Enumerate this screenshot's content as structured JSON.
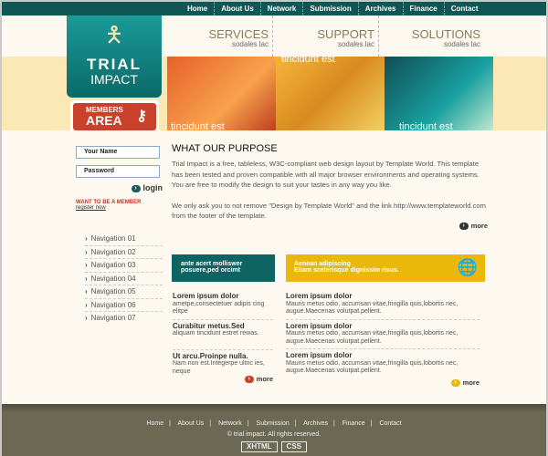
{
  "topnav": [
    "Home",
    "About Us",
    "Network",
    "Submission",
    "Archives",
    "Finance",
    "Contact"
  ],
  "logo": {
    "line1": "TRIAL",
    "line2": "IMPACT"
  },
  "members": {
    "line1": "MEMBERS",
    "line2": "AREA"
  },
  "header": [
    {
      "title": "SERVICES",
      "sub": "sodales lac"
    },
    {
      "title": "SUPPORT",
      "sub": "sodales lac"
    },
    {
      "title": "SOLUTIONS",
      "sub": "sodales lac"
    }
  ],
  "banner": {
    "caption1": "tincidunt est",
    "caption2": "tincidunt est",
    "caption3": "tincidunt est"
  },
  "sidebar": {
    "name_placeholder": "Your Name",
    "password_placeholder": "Password",
    "login": "login",
    "want": "WANT TO BE A MEMBER",
    "register": "register now",
    "nav": [
      "Navigation 01",
      "Navigation 02",
      "Navigation 03",
      "Navigation 04",
      "Navigation 05",
      "Navigation 06",
      "Navigation 07"
    ]
  },
  "main": {
    "title": "WHAT OUR PURPOSE",
    "p1": "Trial Impact is a free, tableless, W3C-compliant web design layout by Template World. This template has been tested and proven compatible with all major browser environments and operating systems. You are free to modify the design to suit your tastes in any way you like.",
    "p2": "We only ask you to not remove \"Design by Template World\" and the link http://www.templateworld.com from the footer of the template.",
    "more": "more"
  },
  "box1": {
    "line1": "ante acert molliswer",
    "line2": "posuere,ped orcimt"
  },
  "box2": {
    "line1": "Aenean adipiscing",
    "line2": "Etiam scelerisque dignissim risus."
  },
  "col1": [
    {
      "title": "Lorem ipsum dolor",
      "text": "ametpe,consectetuer adipis cing elitpe"
    },
    {
      "title": "Curabitur metus.Sed",
      "text": "aliquam tincidunt estret rewas."
    },
    {
      "title": "Ut arcu.Proinpe nulla.",
      "text": "Nam non est.Integerpe ultric ies, neque"
    }
  ],
  "col1_more": "more",
  "col2": [
    {
      "title": "Lorem ipsum dolor",
      "text": "Mauris metus odio, accumsan vitae,fringilla quis,lobortis nec, augue.Maecenas volutpat.pellent."
    },
    {
      "title": "Lorem ipsum dolor",
      "text": "Mauris metus odio, accumsan vitae,fringilla quis,lobortis nec, augue.Maecenas volutpat.pellent."
    },
    {
      "title": "Lorem ipsum dolor",
      "text": "Mauris metus odio, accumsan vitae,fringilla quis,lobortis nec, augue.Maecenas volutpat.pellent."
    }
  ],
  "col2_more": "more",
  "footer": {
    "links": [
      "Home",
      "About Us",
      "Network",
      "Submission",
      "Archives",
      "Finance",
      "Contact"
    ],
    "copyright": "© trial impact. All rights reserved.",
    "badge1": "XHTML",
    "badge2": "CSS"
  }
}
